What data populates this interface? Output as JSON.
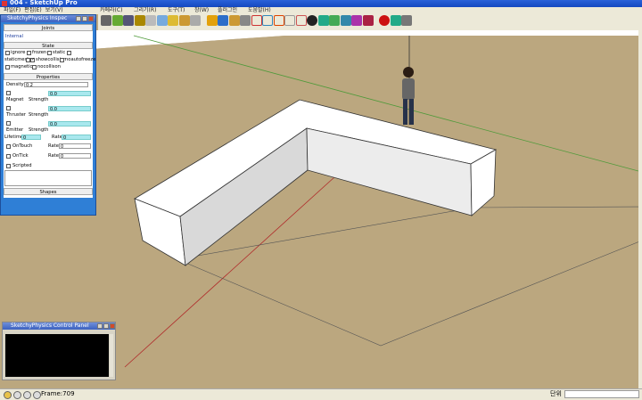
{
  "window": {
    "title": "004 - SketchUp Pro"
  },
  "menu": [
    "파일(F)",
    "편집(E)",
    "보기(V)",
    "카메라(C)",
    "그리기(R)",
    "도구(T)",
    "창(W)",
    "플러그인",
    "도움말(H)"
  ],
  "toolbar": {
    "buttons": [
      {
        "name": "select-tool",
        "color": "#666"
      },
      {
        "name": "paint-tool",
        "color": "#6a3"
      },
      {
        "name": "film-tool",
        "color": "#557"
      },
      {
        "name": "group-tool",
        "color": "#a80"
      },
      {
        "name": "fog-tool",
        "color": "#bbb"
      },
      {
        "name": "box-tool",
        "color": "#7ad"
      },
      {
        "name": "cylinder-tool",
        "color": "#db3"
      },
      {
        "name": "cone-tool",
        "color": "#c93"
      },
      {
        "name": "pipe-tool",
        "color": "#aaa"
      },
      {
        "name": "magnet-tool",
        "color": "#e3a10b"
      },
      {
        "name": "sphere-tool",
        "color": "#2d6ec9"
      },
      {
        "name": "spring-tool",
        "color": "#c93"
      },
      {
        "name": "joint-tool",
        "color": "#888"
      },
      {
        "name": "line-tool",
        "color": "#c33"
      },
      {
        "name": "servo-tool",
        "color": "#38b"
      },
      {
        "name": "gear-tool",
        "color": "#d40"
      },
      {
        "name": "slider-tool",
        "color": "#999"
      },
      {
        "name": "piston-tool",
        "color": "#c55"
      },
      {
        "name": "ball-tool",
        "color": "#222"
      },
      {
        "name": "globe-tool",
        "color": "#2a8"
      },
      {
        "name": "motor-tool",
        "color": "#4a5"
      },
      {
        "name": "lock-tool",
        "color": "#38a"
      },
      {
        "name": "probe-tool",
        "color": "#a3a"
      },
      {
        "name": "delete-tool",
        "color": "#a24"
      },
      {
        "name": "record-button",
        "color": "#c11"
      },
      {
        "name": "rewind-button",
        "color": "#2a8"
      },
      {
        "name": "play-button",
        "color": "#777"
      }
    ]
  },
  "physics_panel": {
    "title": "SketchyPhysics Inspec",
    "joints_header": "Joints",
    "joints_value": "Internal",
    "state_header": "State",
    "state_checks": [
      {
        "label": "ignore",
        "checked": false
      },
      {
        "label": "frozen",
        "checked": false
      },
      {
        "label": "static",
        "checked": false
      },
      {
        "label": "staticmesh",
        "checked": false
      },
      {
        "label": "showcollision",
        "checked": true
      },
      {
        "label": "noautofreeze",
        "checked": false
      },
      {
        "label": "magnetic",
        "checked": false
      },
      {
        "label": "nocollison",
        "checked": false
      }
    ],
    "properties_header": "Properties",
    "density_label": "Density",
    "density_value": "0.2",
    "magnet_label": "Magnet",
    "magnet_strength_label": "Strength",
    "magnet_strength_value": "0.0",
    "thruster_label": "Thruster",
    "thruster_strength_label": "Strength",
    "thruster_strength_value": "0.0",
    "emitter_label": "Emitter",
    "emitter_strength_label": "Strength",
    "emitter_strength_value": "0.0",
    "lifetime_label": "Lifetime",
    "lifetime_value": "0",
    "lifetime_rate_label": "Rate",
    "lifetime_rate_value": "0",
    "ontouch_label": "OnTouch",
    "ontouch_rate_label": "Rate",
    "ontouch_rate_value": "0",
    "ontick_label": "OnTick",
    "ontick_rate_label": "Rate",
    "ontick_rate_value": "0",
    "scripted_label": "Scripted",
    "shapes_header": "Shapes"
  },
  "control_panel": {
    "title": "SketchyPhysics Control Panel"
  },
  "statusbar": {
    "frame": "Frame:709",
    "unit": "단위"
  },
  "scene": {
    "ground_color": "#bba77f",
    "sky_color": "#ffffff",
    "wall_face": "#ffffff",
    "wall_shade": "#d9d9d9"
  }
}
